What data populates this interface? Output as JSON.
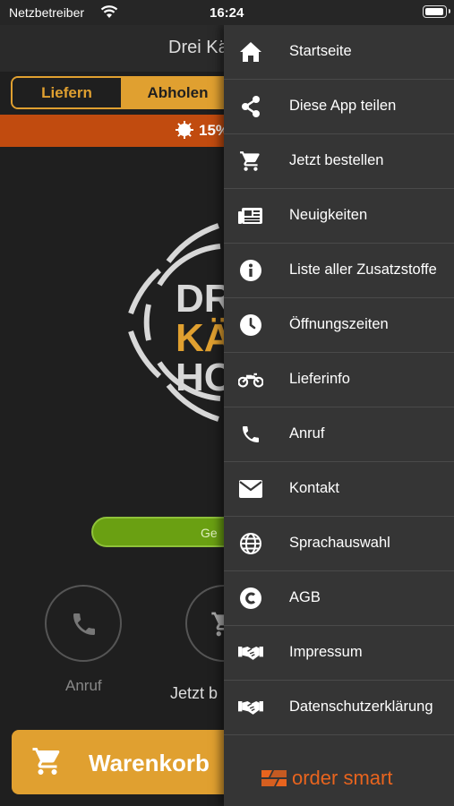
{
  "status_bar": {
    "carrier": "Netzbetreiber",
    "time": "16:24"
  },
  "header": {
    "title": "Drei Kä"
  },
  "order_mode": {
    "deliver_label": "Liefern",
    "pickup_label": "Abholen",
    "selected": "Abholen"
  },
  "promo": {
    "text": "15%"
  },
  "logo": {
    "line1": "DR",
    "line2": "KÄ",
    "line3": "HO"
  },
  "open_status": {
    "label": "Ge"
  },
  "quick_actions": [
    {
      "label": "Anruf",
      "icon": "phone-icon"
    },
    {
      "label": "Jetzt b",
      "icon": "cart-icon"
    }
  ],
  "cart_button": {
    "label": "Warenkorb"
  },
  "menu": {
    "items": [
      {
        "label": "Startseite",
        "icon": "home-icon"
      },
      {
        "label": "Diese App teilen",
        "icon": "share-icon"
      },
      {
        "label": "Jetzt bestellen",
        "icon": "cart-icon"
      },
      {
        "label": "Neuigkeiten",
        "icon": "newspaper-icon"
      },
      {
        "label": "Liste aller Zusatzstoffe",
        "icon": "info-icon"
      },
      {
        "label": "Öffnungszeiten",
        "icon": "clock-icon"
      },
      {
        "label": "Lieferinfo",
        "icon": "motorcycle-icon"
      },
      {
        "label": "Anruf",
        "icon": "phone-icon"
      },
      {
        "label": "Kontakt",
        "icon": "envelope-icon"
      },
      {
        "label": "Sprachauswahl",
        "icon": "globe-icon"
      },
      {
        "label": "AGB",
        "icon": "copyright-icon"
      },
      {
        "label": "Impressum",
        "icon": "handshake-icon"
      },
      {
        "label": "Datenschutzerklärung",
        "icon": "handshake-icon"
      }
    ],
    "brand": "order smart"
  },
  "colors": {
    "accent": "#e0a030",
    "promo": "#c14b0f",
    "open": "#6aa012",
    "drawer": "#353535",
    "brand": "#e8641e"
  }
}
